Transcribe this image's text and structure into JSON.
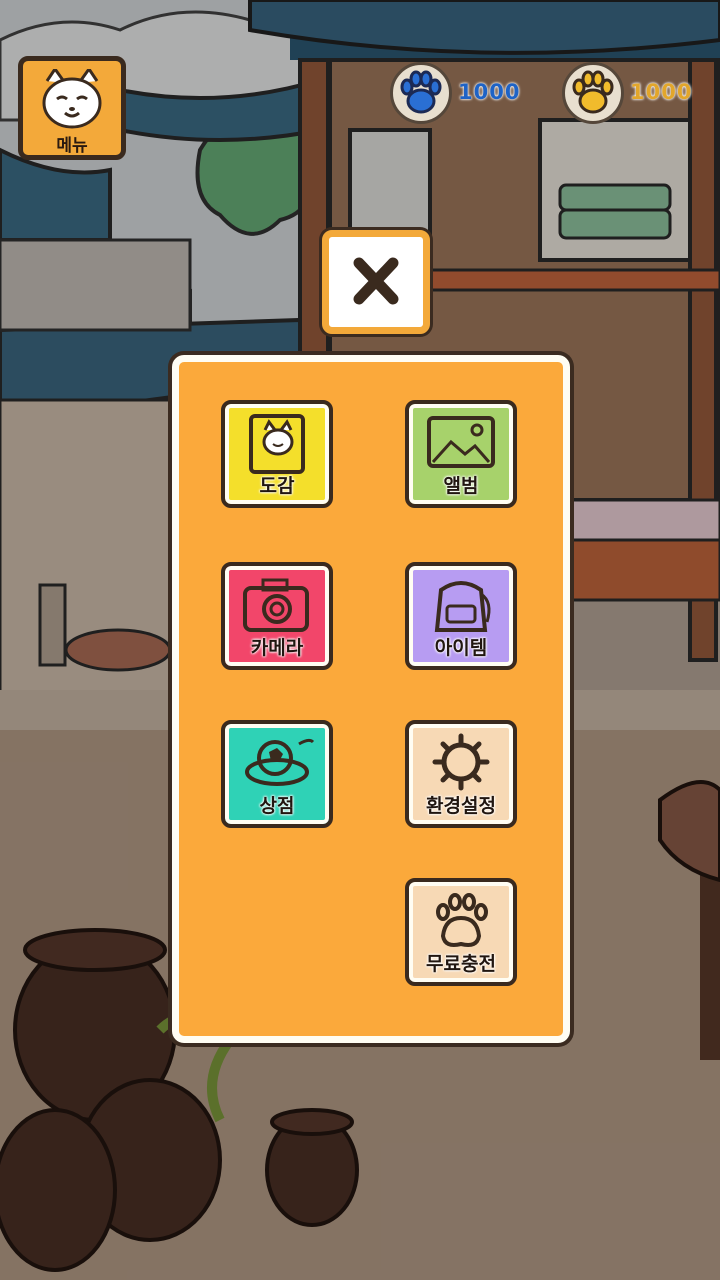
{
  "hud": {
    "menu_label": "메뉴",
    "blue_paw_amount": "1000",
    "gold_paw_amount": "1000"
  },
  "menu_items": [
    {
      "id": "dogam",
      "label": "도감",
      "color": "#f4df2b",
      "icon": "book-cat-icon"
    },
    {
      "id": "album",
      "label": "앨범",
      "color": "#a7d26b",
      "icon": "picture-icon"
    },
    {
      "id": "camera",
      "label": "카메라",
      "color": "#f2466a",
      "icon": "camera-icon"
    },
    {
      "id": "item",
      "label": "아이템",
      "color": "#b79cf2",
      "icon": "backpack-icon"
    },
    {
      "id": "shop",
      "label": "상점",
      "color": "#2fd2b6",
      "icon": "ball-basket-icon"
    },
    {
      "id": "settings",
      "label": "환경설정",
      "color": "#f7d9b5",
      "icon": "gear-icon"
    },
    {
      "id": "free",
      "label": "무료충전",
      "color": "#f7d9b5",
      "icon": "paw-icon"
    }
  ]
}
